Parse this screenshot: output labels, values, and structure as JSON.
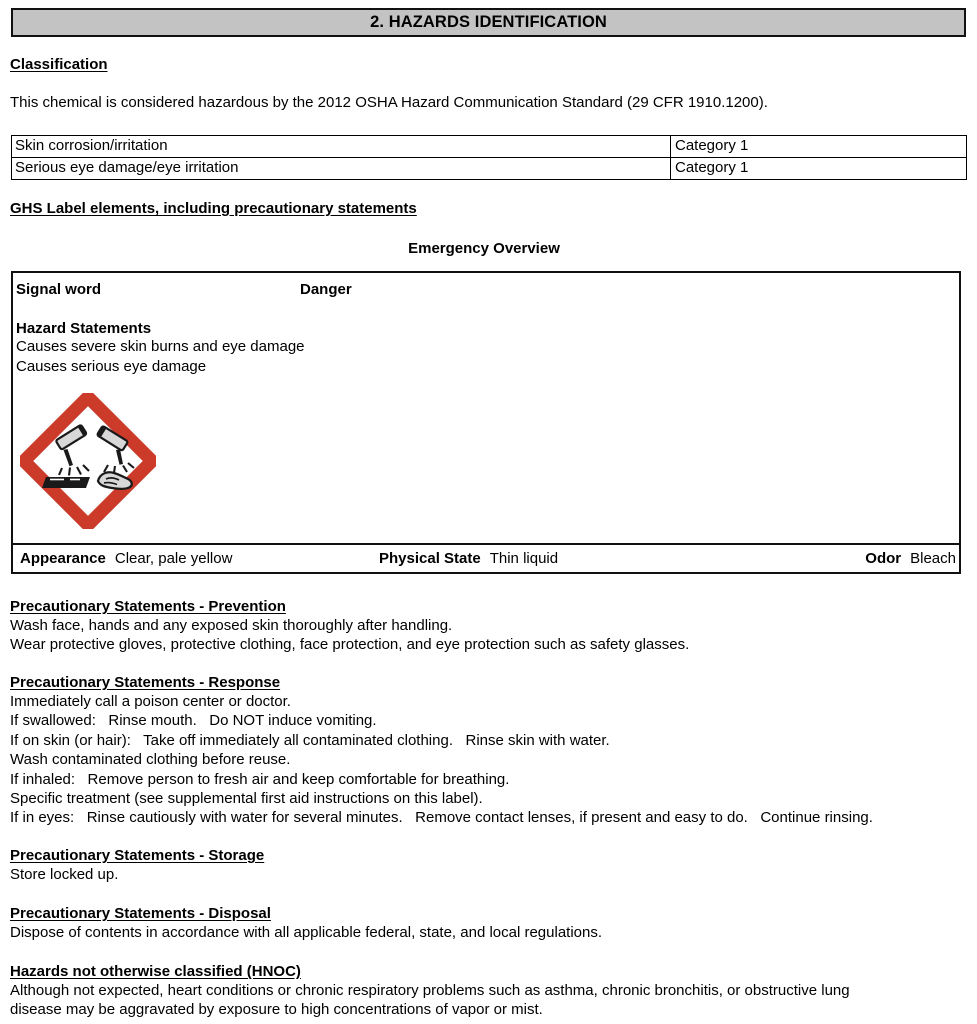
{
  "section": {
    "title": "2. HAZARDS IDENTIFICATION"
  },
  "classification": {
    "heading": "Classification",
    "intro": "This chemical is considered hazardous by the 2012 OSHA Hazard Communication Standard (29 CFR 1910.1200).",
    "rows": [
      {
        "hazard": "Skin corrosion/irritation",
        "category": "Category 1"
      },
      {
        "hazard": "Serious eye damage/eye irritation",
        "category": "Category 1"
      }
    ]
  },
  "ghs": {
    "heading": "GHS Label elements, including precautionary statements",
    "emergency_overview_title": "Emergency Overview",
    "signal_word_label": "Signal word",
    "signal_word_value": "Danger",
    "hazard_statements_heading": "Hazard Statements",
    "hazard_statements": [
      "Causes severe skin burns and eye damage",
      "Causes serious eye damage"
    ],
    "pictogram_name": "GHS corrosion pictogram",
    "pictogram_border_color": "#cc3b2a",
    "appearance": {
      "appearance_key": "Appearance",
      "appearance_value": "Clear, pale yellow",
      "physical_state_key": "Physical State",
      "physical_state_value": "Thin liquid",
      "odor_key": "Odor",
      "odor_value": "Bleach"
    }
  },
  "precautionary": {
    "prevention": {
      "heading": "Precautionary Statements - Prevention",
      "lines": [
        "Wash face, hands and any exposed skin thoroughly after handling.",
        "Wear protective gloves, protective clothing, face protection, and eye protection such as safety glasses."
      ]
    },
    "response": {
      "heading": "Precautionary Statements - Response",
      "lines": [
        "Immediately call a poison center or doctor.",
        "If swallowed:   Rinse mouth.   Do NOT induce vomiting.",
        "If on skin (or hair):   Take off immediately all contaminated clothing.   Rinse skin with water.",
        "Wash contaminated clothing before reuse.",
        "If inhaled:   Remove person to fresh air and keep comfortable for breathing.",
        "Specific treatment (see supplemental first aid instructions on this label).",
        "If in eyes:   Rinse cautiously with water for several minutes.   Remove contact lenses, if present and easy to do.   Continue rinsing."
      ]
    },
    "storage": {
      "heading": "Precautionary Statements - Storage",
      "lines": [
        "Store locked up."
      ]
    },
    "disposal": {
      "heading": "Precautionary Statements - Disposal",
      "lines": [
        "Dispose of contents in accordance with all applicable federal, state, and local regulations."
      ]
    }
  },
  "hnoc": {
    "heading": "Hazards not otherwise classified (HNOC)",
    "lines": [
      "Although not expected, heart conditions or chronic respiratory problems such as asthma, chronic bronchitis, or obstructive lung",
      "disease may be aggravated by exposure to high concentrations of vapor or mist."
    ]
  }
}
